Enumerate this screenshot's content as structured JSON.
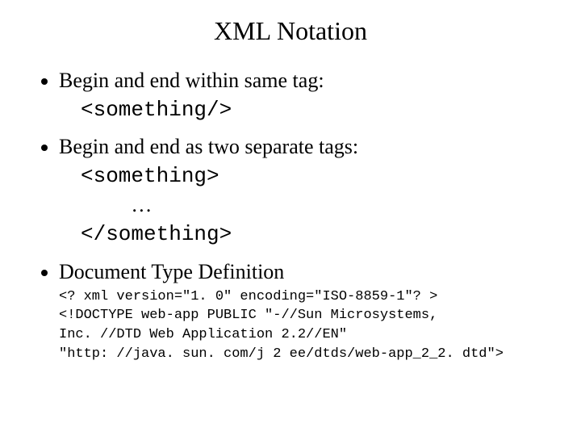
{
  "title": "XML Notation",
  "bullets": {
    "b1": "Begin and end within same tag:",
    "b2": "Begin and end as two separate tags:",
    "b3": "Document Type Definition"
  },
  "code1": "<something/>",
  "code2_line1": "<something>",
  "code2_line2": "    ",
  "code2_dots": "…",
  "code2_line3": "</something>",
  "dtd_line1": "<? xml version=\"1. 0\" encoding=\"ISO-8859-1\"? >",
  "dtd_line2": "<!DOCTYPE web-app PUBLIC \"-//Sun Microsystems,",
  "dtd_line3": "Inc. //DTD Web Application 2.2//EN\"",
  "dtd_line4": "\"http: //java. sun. com/j 2 ee/dtds/web-app_2_2. dtd\">"
}
